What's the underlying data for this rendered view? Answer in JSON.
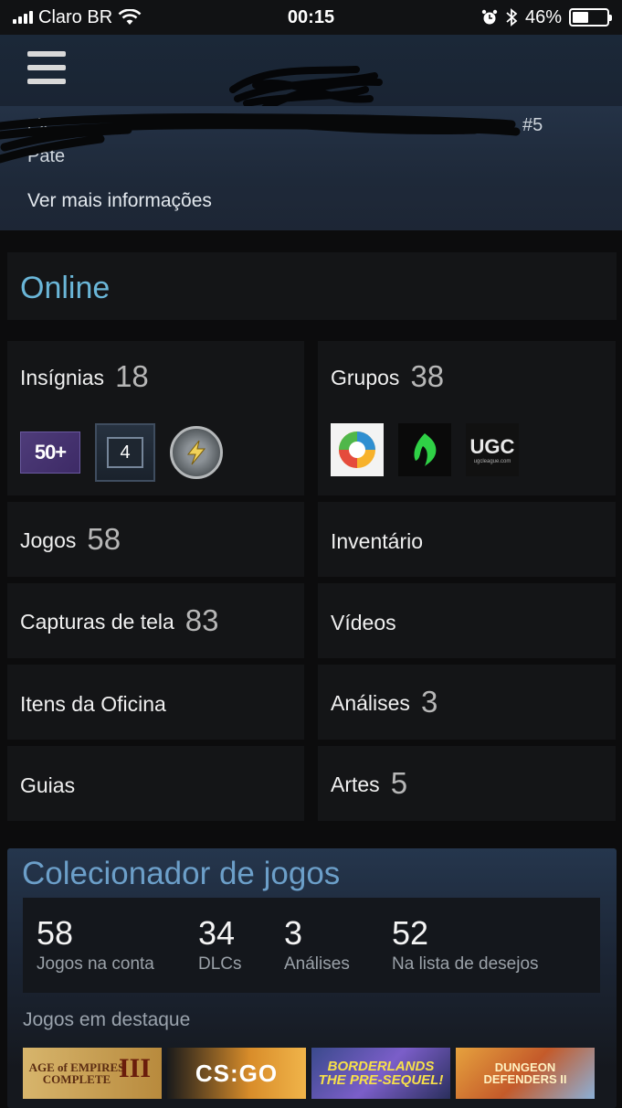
{
  "status_bar": {
    "carrier": "Claro BR",
    "time": "00:15",
    "battery": "46%",
    "battery_level": 0.46
  },
  "profile": {
    "fragment_left": "eX",
    "fragment_right": "#5",
    "fragment_second": "Pate",
    "more_info": "Ver mais informações"
  },
  "status": {
    "online": "Online"
  },
  "tiles": {
    "badges": {
      "label": "Insígnias",
      "count": "18"
    },
    "groups": {
      "label": "Grupos",
      "count": "38"
    },
    "games": {
      "label": "Jogos",
      "count": "58"
    },
    "inventory": {
      "label": "Inventário"
    },
    "screenshots": {
      "label": "Capturas de tela",
      "count": "83"
    },
    "videos": {
      "label": "Vídeos"
    },
    "workshop": {
      "label": "Itens da Oficina"
    },
    "reviews": {
      "label": "Análises",
      "count": "3"
    },
    "guides": {
      "label": "Guias"
    },
    "artwork": {
      "label": "Artes",
      "count": "5"
    }
  },
  "badge_items": {
    "level": "50+",
    "years": "4"
  },
  "group_items": {
    "ugc": "UGC",
    "ugc_sub": "ugcleague.com"
  },
  "collector": {
    "title": "Colecionador de jogos",
    "stats": [
      {
        "num": "58",
        "label": "Jogos na conta"
      },
      {
        "num": "34",
        "label": "DLCs"
      },
      {
        "num": "3",
        "label": "Análises"
      },
      {
        "num": "52",
        "label": "Na lista de desejos"
      }
    ],
    "featured_label": "Jogos em destaque",
    "featured": [
      {
        "line1": "AGE of EMPIRES",
        "line2": "COMPLETE",
        "line3": "III"
      },
      {
        "line1": "CS:GO"
      },
      {
        "line1": "BORDERLANDS",
        "line2": "THE PRE-SEQUEL!"
      },
      {
        "line1": "DUNGEON",
        "line2": "DEFENDERS II"
      }
    ]
  }
}
